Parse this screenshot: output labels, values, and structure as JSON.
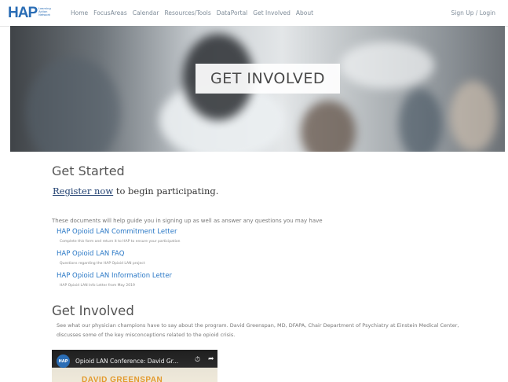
{
  "logo": {
    "mark": "HAP",
    "sub": "Learning Action Network"
  },
  "nav": {
    "items": [
      "Home",
      "FocusAreas",
      "Calendar",
      "Resources/Tools",
      "DataPortal",
      "Get Involved",
      "About"
    ],
    "signup": "Sign Up / Login"
  },
  "hero": {
    "title": "GET INVOLVED"
  },
  "get_started": {
    "heading": "Get Started",
    "register_link": "Register now",
    "register_rest": " to begin participating."
  },
  "documents": {
    "intro": "These documents will help guide you in signing up as well as answer any questions you may have",
    "items": [
      {
        "title": "HAP Opioid LAN Commitment Letter",
        "desc": "Complete this form and return it to HAP to ensure your participation"
      },
      {
        "title": "HAP Opioid LAN FAQ",
        "desc": "Questions regarding the HAP Opioid LAN project"
      },
      {
        "title": "HAP Opioid LAN Information Letter",
        "desc": "HAP Opioid LAN Info Letter from May 2019"
      }
    ]
  },
  "get_involved": {
    "heading": "Get Involved",
    "paragraph": "See what our physician champions have to say about the program. David Greenspan, MD, DFAPA, Chair Department of Psychiatry at Einstein Medical Center, discusses some of the key misconceptions related to the opioid crisis."
  },
  "video": {
    "channel_badge": "HAP",
    "title": "Opioid LAN Conference: David Gr...",
    "clock_icon": "clock-icon",
    "share_icon": "share-icon",
    "thumbnail_name": "DAVID GREENSPAN"
  }
}
